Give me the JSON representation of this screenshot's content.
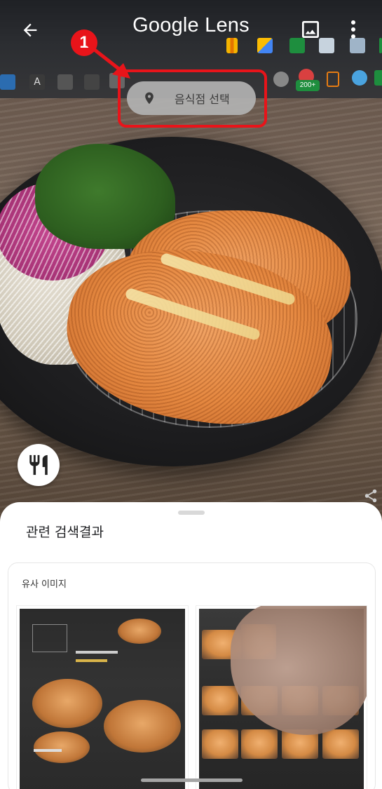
{
  "header": {
    "app_title": "Google Lens",
    "back_icon": "arrow-back-icon",
    "gallery_icon": "image-gallery-icon",
    "more_icon": "more-vert-icon"
  },
  "annotation": {
    "step_number": "1",
    "color": "#e8141a"
  },
  "place_chip": {
    "label": "음식점 선택",
    "icon": "location-pin-icon"
  },
  "fab": {
    "icon": "restaurant-icon"
  },
  "taskbar": {
    "badge": "200+"
  },
  "sheet": {
    "title": "관련 검색결과",
    "section_title": "유사 이미지",
    "thumbnails": [
      {
        "name": "similar-image-menu-1"
      },
      {
        "name": "similar-image-menu-2"
      }
    ]
  }
}
